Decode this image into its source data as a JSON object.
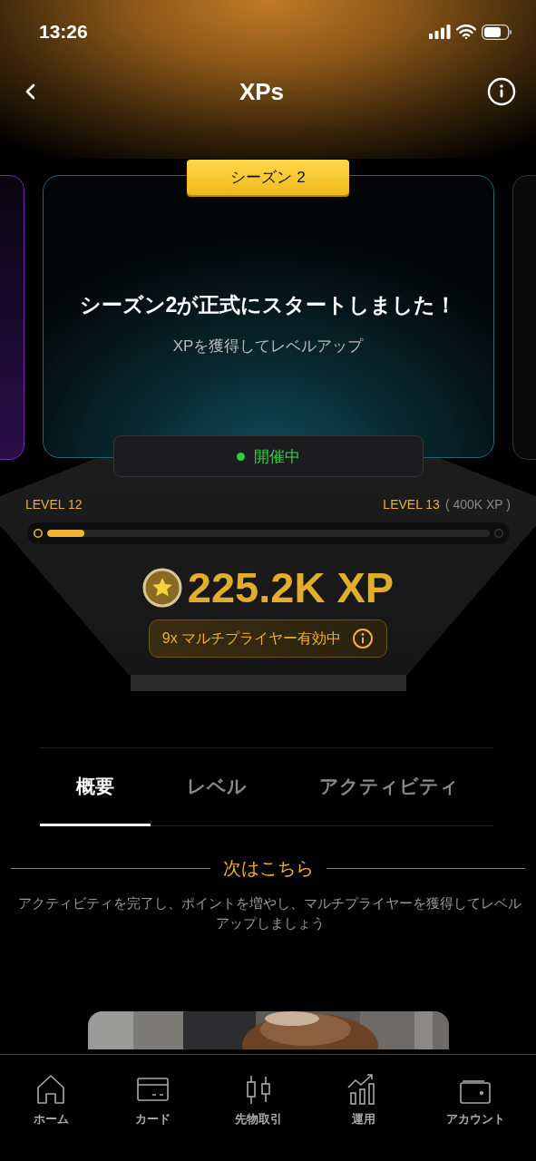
{
  "status_bar": {
    "time": "13:26"
  },
  "header": {
    "title": "XPs"
  },
  "season": {
    "badge": "シーズン 2",
    "headline": "シーズン2が正式にスタートしました！",
    "subtitle": "XPを獲得してレベルアップ"
  },
  "status": {
    "label": "開催中",
    "active": true
  },
  "progress": {
    "current_level": "LEVEL 12",
    "next_level": "LEVEL 13",
    "next_xp": "( 400K XP )",
    "level": 0.085
  },
  "xp": {
    "amount": "225.2K XP",
    "multiplier": "9x マルチプライヤー有効中"
  },
  "tabs": [
    {
      "label": "概要",
      "selected": true
    },
    {
      "label": "レベル",
      "selected": false
    },
    {
      "label": "アクティビティ",
      "selected": false
    }
  ],
  "section": {
    "title": "次はこちら",
    "description": "アクティビティを完了し、ポイントを増やし、マルチプライヤーを獲得してレベルアップしましょう"
  },
  "nav": [
    {
      "label": "ホーム",
      "kind": "home"
    },
    {
      "label": "カード",
      "kind": "card"
    },
    {
      "label": "先物取引",
      "kind": "futures"
    },
    {
      "label": "運用",
      "kind": "earn"
    },
    {
      "label": "アカウント",
      "kind": "account"
    }
  ]
}
